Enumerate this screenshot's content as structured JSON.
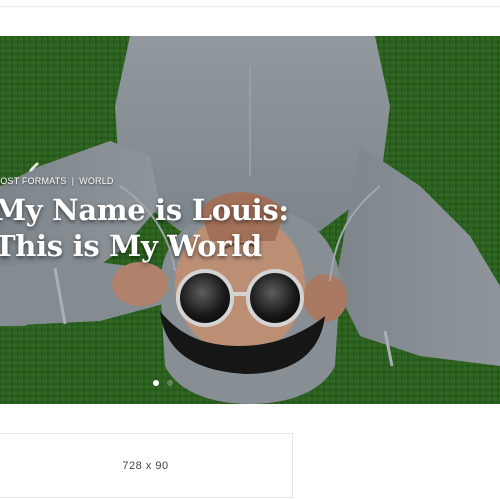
{
  "hero": {
    "categories": [
      "Post Formats",
      "World"
    ],
    "separator": "|",
    "title_line_1": "My Name is Louis:",
    "title_line_2": "This is My World",
    "slider": {
      "total": 2,
      "active_index": 0
    }
  },
  "ad": {
    "label": "728 x 90"
  },
  "colors": {
    "grass": "#2f6b24",
    "hoodie": "#9aa3aa",
    "text": "#ffffff",
    "border": "#e6e6e6"
  },
  "icons": {
    "category_icon": "pencil-icon"
  }
}
